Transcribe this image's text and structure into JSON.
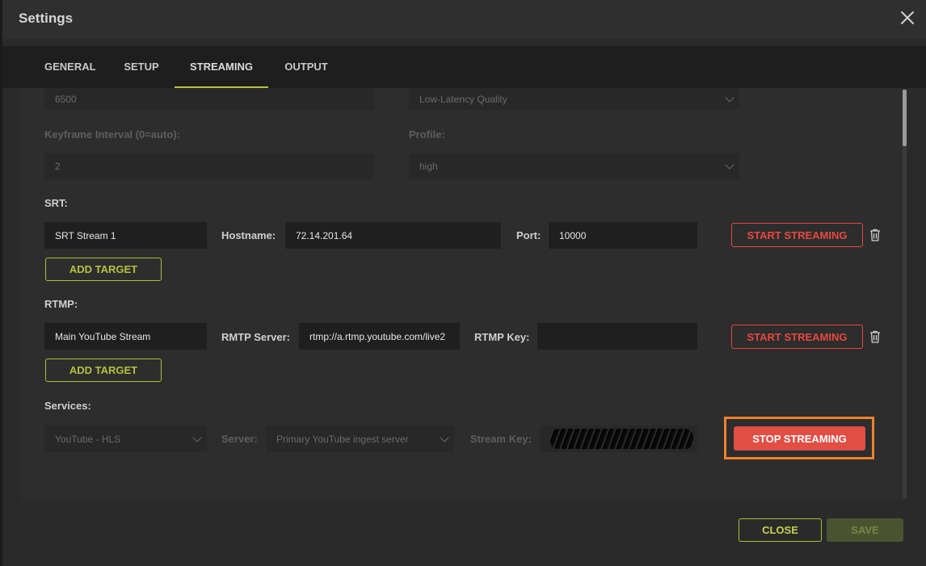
{
  "dialog": {
    "title": "Settings"
  },
  "tabs": [
    {
      "label": "GENERAL"
    },
    {
      "label": "SETUP"
    },
    {
      "label": "STREAMING",
      "active": true
    },
    {
      "label": "OUTPUT"
    }
  ],
  "encoder": {
    "bitrate_value": "6500",
    "preset_value": "Low-Latency Quality",
    "keyframe_label": "Keyframe Interval (0=auto):",
    "keyframe_value": "2",
    "profile_label": "Profile:",
    "profile_value": "high"
  },
  "srt": {
    "section_label": "SRT:",
    "name_value": "SRT Stream 1",
    "hostname_label": "Hostname:",
    "hostname_value": "72.14.201.64",
    "port_label": "Port:",
    "port_value": "10000",
    "start_label": "START STREAMING",
    "add_target_label": "ADD TARGET"
  },
  "rtmp": {
    "section_label": "RTMP:",
    "name_value": "Main YouTube Stream",
    "server_label": "RMTP Server:",
    "server_value": "rtmp://a.rtmp.youtube.com/live2",
    "key_label": "RTMP Key:",
    "key_value": "",
    "start_label": "START STREAMING",
    "add_target_label": "ADD TARGET"
  },
  "services": {
    "section_label": "Services:",
    "service_value": "YouTube - HLS",
    "server_label": "Server:",
    "server_value": "Primary YouTube ingest server",
    "stream_key_label": "Stream Key:",
    "stop_label": "STOP STREAMING"
  },
  "footer": {
    "close_label": "CLOSE",
    "save_label": "SAVE"
  },
  "colors": {
    "accent": "#b5c438",
    "danger": "#e14e44",
    "highlight": "#f0822a"
  }
}
